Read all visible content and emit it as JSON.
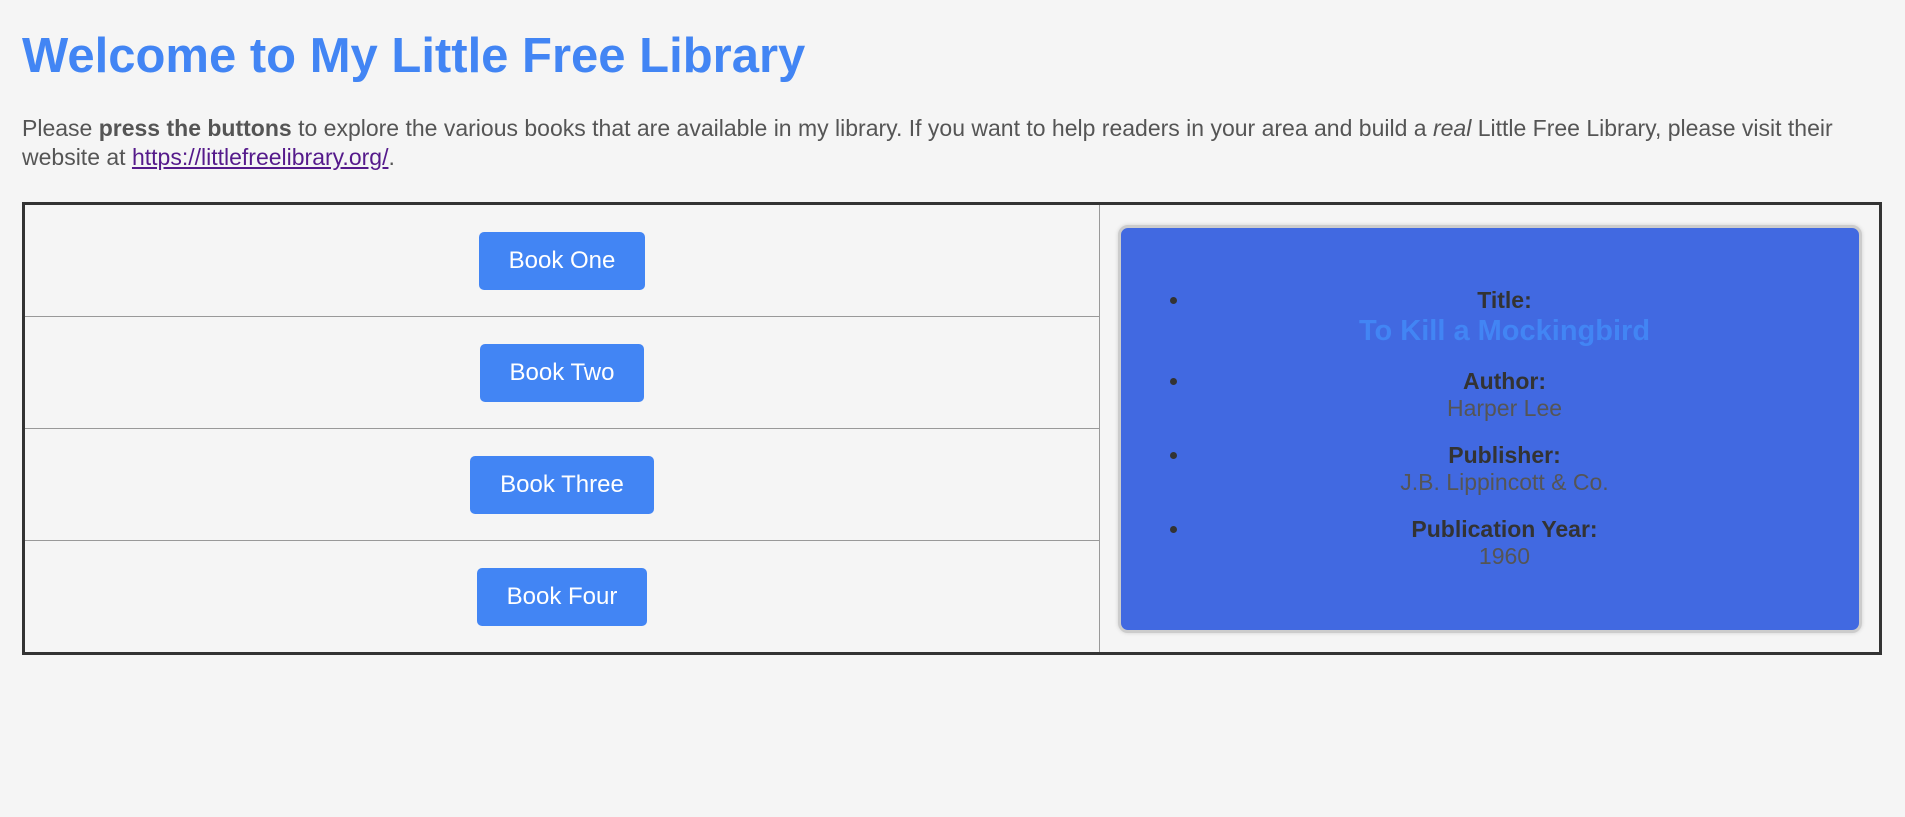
{
  "header": {
    "title": "Welcome to My Little Free Library"
  },
  "intro": {
    "part1": "Please ",
    "bold": "press the buttons",
    "part2": " to explore the various books that are available in my library. If you want to help readers in your area and build a ",
    "italic": "real",
    "part3": " Little Free Library, please visit their website at ",
    "link": "https://littlefreelibrary.org/",
    "part4": "."
  },
  "buttons": [
    "Book One",
    "Book Two",
    "Book Three",
    "Book Four"
  ],
  "book": {
    "title_label": "Title:",
    "title": "To Kill a Mockingbird",
    "author_label": "Author:",
    "author": "Harper Lee",
    "publisher_label": "Publisher:",
    "publisher": "J.B. Lippincott & Co.",
    "year_label": "Publication Year:",
    "year": "1960"
  },
  "colors": {
    "accent": "#4285f4",
    "card": "#4169e1",
    "link": "#551a8b"
  }
}
